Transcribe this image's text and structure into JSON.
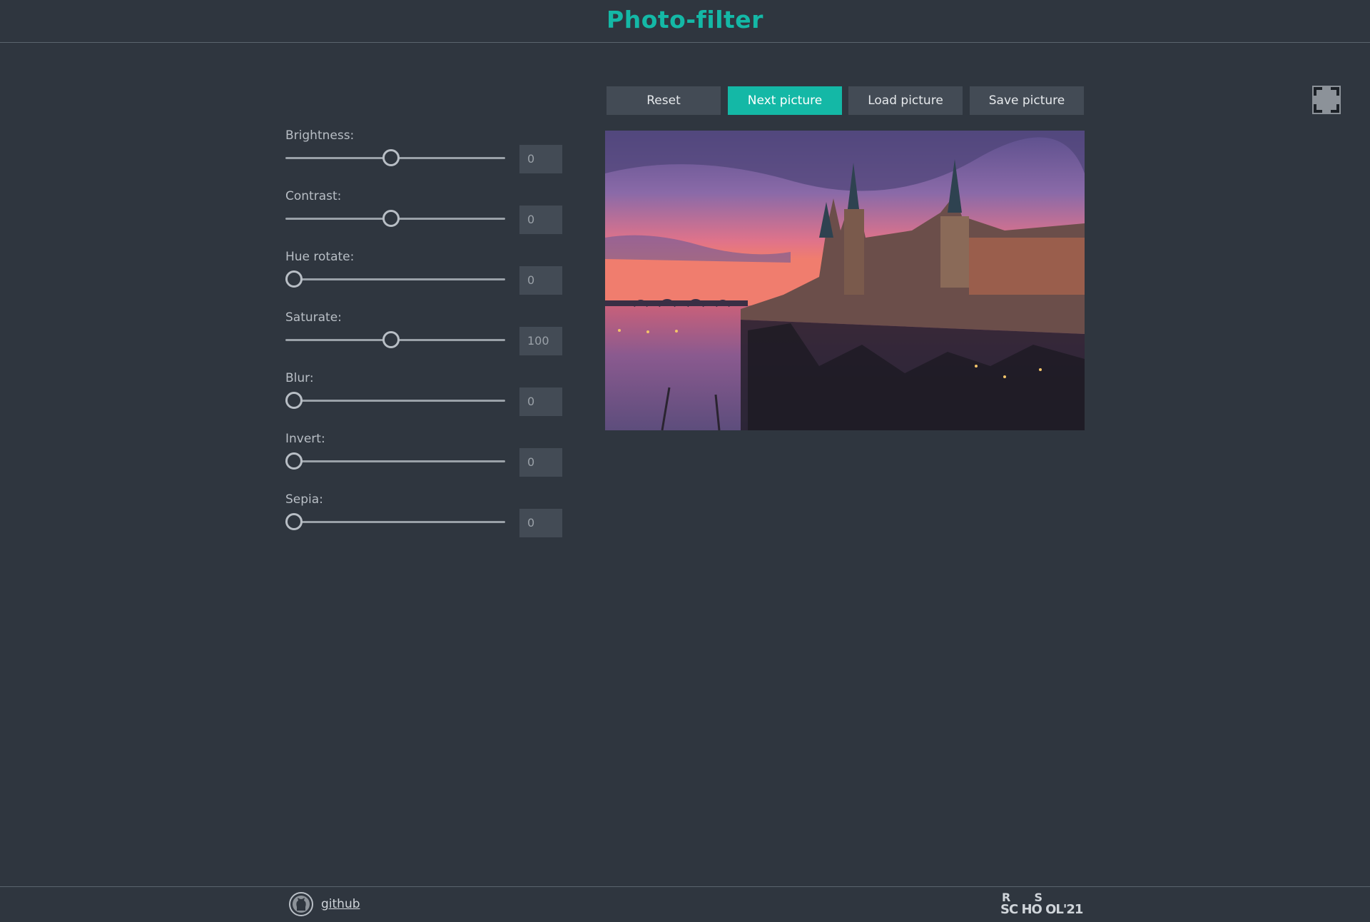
{
  "header": {
    "title": "Photo-filter"
  },
  "toolbar": {
    "buttons": [
      {
        "label": "Reset",
        "active": false
      },
      {
        "label": "Next picture",
        "active": true
      },
      {
        "label": "Load picture",
        "active": false
      },
      {
        "label": "Save picture",
        "active": false
      }
    ]
  },
  "filters": [
    {
      "label": "Brightness:",
      "value": "0",
      "level": 0.5
    },
    {
      "label": "Contrast:",
      "value": "0",
      "level": 0.5
    },
    {
      "label": "Hue rotate:",
      "value": "0",
      "level": 0.0
    },
    {
      "label": "Saturate:",
      "value": "100",
      "level": 0.5
    },
    {
      "label": "Blur:",
      "value": "0",
      "level": 0.0
    },
    {
      "label": "Invert:",
      "value": "0",
      "level": 0.0
    },
    {
      "label": "Sepia:",
      "value": "0",
      "level": 0.0
    }
  ],
  "footer": {
    "github_label": "github",
    "logo_text": "RS SCHOOL'21"
  },
  "colors": {
    "background": "#2f363f",
    "accent": "#14b8a6",
    "button": "#434b55"
  },
  "icons": [
    "fullscreen-icon",
    "github-icon",
    "rs-school-logo"
  ]
}
